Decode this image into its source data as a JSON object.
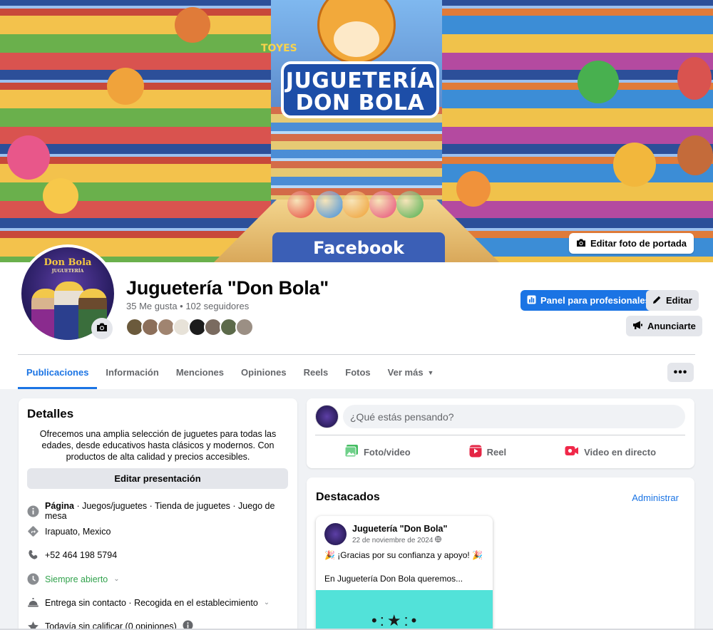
{
  "cover": {
    "logo_line1": "JUGUETERÍA",
    "logo_line2": "DON BOLA",
    "sign_text": "Facebook",
    "store_sign": "TOYES",
    "edit_cover_label": "Editar foto de portada"
  },
  "profile": {
    "avatar_title": "Don Bola",
    "avatar_subtitle": "JUGUETERÍA",
    "name": "Juguetería \"Don Bola\"",
    "stats": "35 Me gusta • 102 seguidores",
    "followers": [
      "#6b5a3c",
      "#8c6f5a",
      "#a08470",
      "#e7e2d8",
      "#1c1c1c",
      "#7a6b60",
      "#5c6a4a",
      "#9b8f84"
    ]
  },
  "actions": {
    "dashboard_label": "Panel para profesionales",
    "edit_label": "Editar",
    "advertise_label": "Anunciarte",
    "more_label": "•••"
  },
  "tabs": [
    {
      "label": "Publicaciones"
    },
    {
      "label": "Información"
    },
    {
      "label": "Menciones"
    },
    {
      "label": "Opiniones"
    },
    {
      "label": "Reels"
    },
    {
      "label": "Fotos"
    },
    {
      "label": "Ver más"
    }
  ],
  "details": {
    "title": "Detalles",
    "bio": "Ofrecemos una amplia selección de juguetes para todas las edades, desde educativos hasta clásicos y modernos. Con productos de alta calidad y precios accesibles.",
    "edit_intro_label": "Editar presentación",
    "page_prefix": "Página",
    "page_categories": " · Juegos/juguetes · Tienda de juguetes · Juego de mesa",
    "location": "Irapuato, Mexico",
    "phone": "+52 464 198 5794",
    "hours": "Siempre abierto",
    "services": "Entrega sin contacto · Recogida en el establecimiento",
    "rating": "Todavía sin calificar (0 opiniones)"
  },
  "composer": {
    "placeholder": "¿Qué estás pensando?",
    "photo_label": "Foto/video",
    "reel_label": "Reel",
    "live_label": "Video en directo"
  },
  "featured": {
    "title": "Destacados",
    "manage_label": "Administrar",
    "post": {
      "author": "Juguetería \"Don Bola\"",
      "date": "22 de noviembre de 2024",
      "line1": "¡Gracias por su confianza y apoyo!",
      "line2": "En Juguetería Don Bola queremos..."
    }
  },
  "colors": {
    "accent": "#1b74e4",
    "open_status": "#31a24c",
    "post_image_bg": "#52e2d9"
  }
}
